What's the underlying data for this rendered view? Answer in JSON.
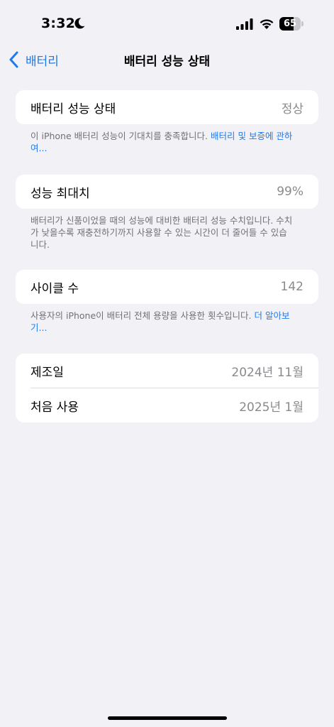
{
  "status_bar": {
    "time": "3:32",
    "battery_percent": "65",
    "battery_level": 0.65
  },
  "nav": {
    "back_label": "배터리",
    "title": "배터리 성능 상태"
  },
  "health": {
    "label": "배터리 성능 상태",
    "value": "정상",
    "footer_text": "이 iPhone 배터리 성능이 기대치를 충족합니다. ",
    "footer_link": "배터리 및 보증에 관하여..."
  },
  "max_capacity": {
    "label": "성능 최대치",
    "value": "99%",
    "footer_text": "배터리가 신품이었을 때의 성능에 대비한 배터리 성능 수치입니다. 수치가 낮을수록 재충전하기까지 사용할 수 있는 시간이 더 줄어들 수 있습니다."
  },
  "cycle_count": {
    "label": "사이클 수",
    "value": "142",
    "footer_text": "사용자의 iPhone이 배터리 전체 용량을 사용한 횟수입니다. ",
    "footer_link": "더 알아보기..."
  },
  "dates": {
    "manufacture_label": "제조일",
    "manufacture_value": "2024년 11월",
    "first_use_label": "처음 사용",
    "first_use_value": "2025년 1월"
  },
  "colors": {
    "accent": "#1f7aee",
    "background": "#f2f1f6",
    "secondary_text": "#8a8a8e"
  }
}
